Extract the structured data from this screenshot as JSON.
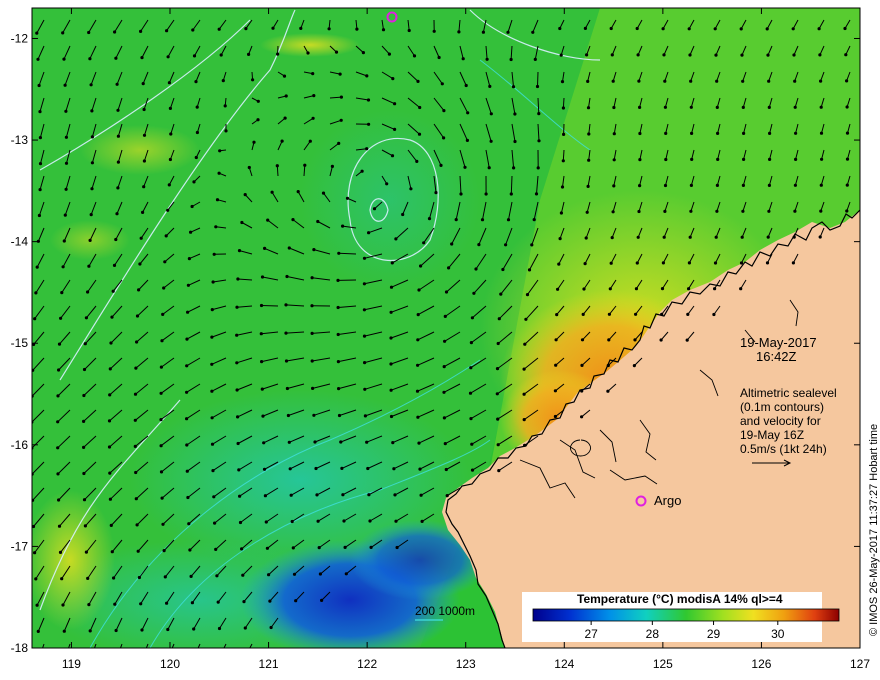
{
  "map": {
    "lon_ticks": [
      "119",
      "120",
      "121",
      "122",
      "123",
      "124",
      "125",
      "126",
      "127"
    ],
    "lat_ticks": [
      "-12",
      "-13",
      "-14",
      "-15",
      "-16",
      "-17",
      "-18"
    ],
    "lon_range": [
      118.6,
      127.0
    ],
    "lat_range": [
      -18.0,
      -11.7
    ]
  },
  "annotation": {
    "date": "19-May-2017",
    "time": "16:42Z",
    "lines": [
      "Altimetric sealevel",
      "(0.1m contours)",
      "and velocity for",
      "19-May 16Z",
      "0.5m/s (1kt 24h)"
    ]
  },
  "argo": {
    "label": "Argo",
    "color": "#e020e0"
  },
  "isobath_label": "200  1000m",
  "colorbar": {
    "title": "Temperature (°C) modisA 14% ql>=4",
    "ticks": [
      "27",
      "28",
      "29",
      "30"
    ]
  },
  "credit": "© IMOS 26-May-2017 11:37:27 Hobart time",
  "colors": {
    "land": "#f5c79e",
    "sea_green": "#2cc234",
    "sea_cyan": "#20c8b0",
    "sea_blue": "#1060d0",
    "sea_yellow": "#e8d820",
    "sea_orange": "#f0a020",
    "coast": "#000000",
    "arrow": "#000000",
    "contour": "#d8f0ff",
    "isobath": "#40e0e0"
  }
}
